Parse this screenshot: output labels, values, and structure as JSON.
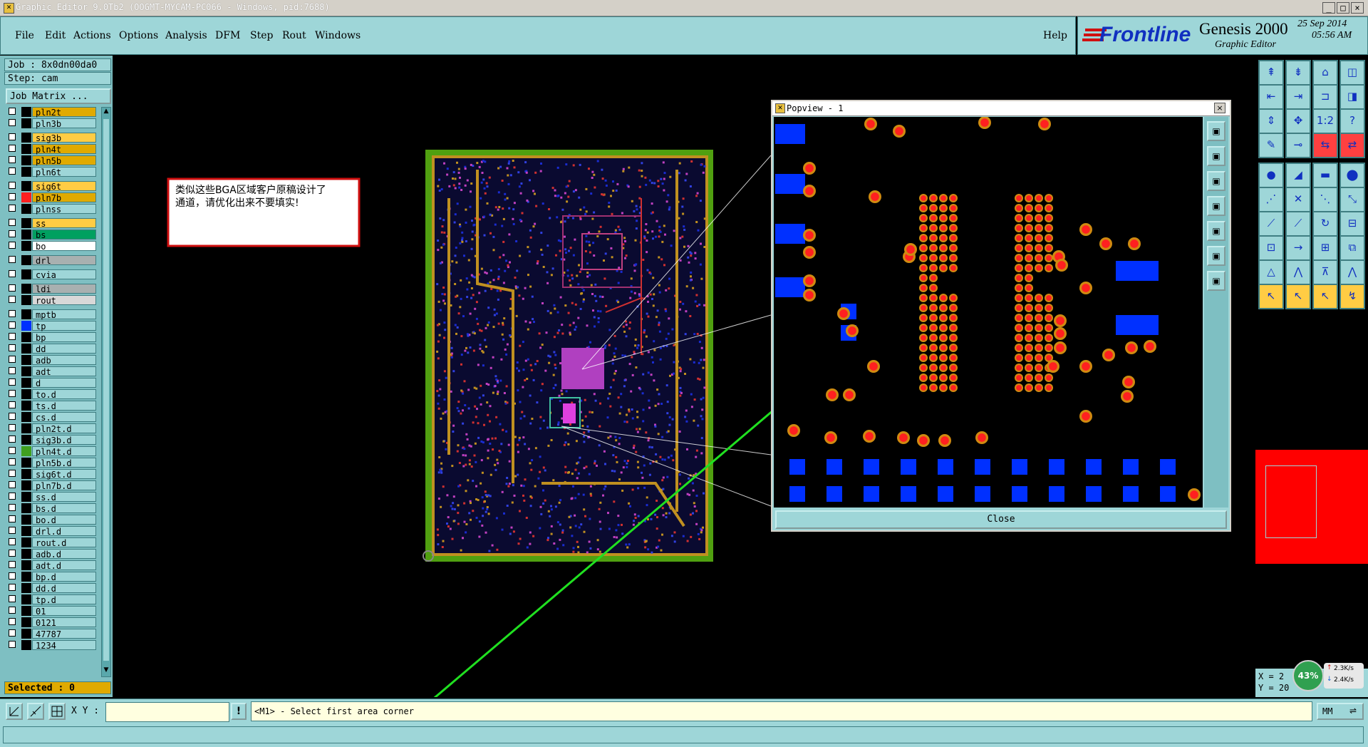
{
  "window": {
    "title": "Graphic Editor 9.0Tb2 (OOGMT-MYCAM-PC066 - Windows, pid:7688)"
  },
  "menubar": {
    "items": [
      "File",
      "Edit",
      "Actions",
      "Options",
      "Analysis",
      "DFM",
      "Step",
      "Rout",
      "Windows"
    ],
    "help": "Help"
  },
  "brand": {
    "logo": "Frontline",
    "product": "Genesis 2000",
    "subtitle": "Graphic Editor",
    "date": "25 Sep 2014",
    "time": "05:56 AM"
  },
  "left_panel": {
    "job": "Job : 8x0dn00da0",
    "step": "Step: cam",
    "job_matrix": "Job Matrix ...",
    "selected": "Selected : 0",
    "layers": [
      {
        "name": "pln2t",
        "color": "#e0aa00",
        "swatch": "#000"
      },
      {
        "name": "pln3b",
        "color": "#9ed6d8",
        "swatch": "#000"
      },
      {
        "name": "sig3b",
        "color": "#ffcc44",
        "swatch": "#000"
      },
      {
        "name": "pln4t",
        "color": "#e0aa00",
        "swatch": "#000"
      },
      {
        "name": "pln5b",
        "color": "#e0aa00",
        "swatch": "#000"
      },
      {
        "name": "pln6t",
        "color": "#9ed6d8",
        "swatch": "#000"
      },
      {
        "name": "sig6t",
        "color": "#ffcc44",
        "swatch": "#000"
      },
      {
        "name": "pln7b",
        "color": "#e0aa00",
        "swatch": "#ff2020"
      },
      {
        "name": "plnss",
        "color": "#9ed6d8",
        "swatch": "#000"
      },
      {
        "name": "ss",
        "color": "#ffcc44",
        "swatch": "#000"
      },
      {
        "name": "bs",
        "color": "#00a060",
        "swatch": "#000"
      },
      {
        "name": "bo",
        "color": "#ffffff",
        "swatch": "#000"
      },
      {
        "name": "drl",
        "color": "#a8b0b0",
        "swatch": "#000"
      },
      {
        "name": "cvia",
        "color": "#9ed6d8",
        "swatch": "#000"
      },
      {
        "name": "ldi",
        "color": "#a8b0b0",
        "swatch": "#000"
      },
      {
        "name": "rout",
        "color": "#d8d8d8",
        "swatch": "#000"
      },
      {
        "name": "mptb",
        "color": "#9ed6d8",
        "swatch": "#000"
      },
      {
        "name": "tp",
        "color": "#9ed6d8",
        "swatch": "#0030ff"
      },
      {
        "name": "bp",
        "color": "#9ed6d8",
        "swatch": "#000"
      },
      {
        "name": "dd",
        "color": "#9ed6d8",
        "swatch": "#000"
      },
      {
        "name": "adb",
        "color": "#9ed6d8",
        "swatch": "#000"
      },
      {
        "name": "adt",
        "color": "#9ed6d8",
        "swatch": "#000"
      },
      {
        "name": "d",
        "color": "#9ed6d8",
        "swatch": "#000"
      },
      {
        "name": "to.d",
        "color": "#9ed6d8",
        "swatch": "#000"
      },
      {
        "name": "ts.d",
        "color": "#9ed6d8",
        "swatch": "#000"
      },
      {
        "name": "cs.d",
        "color": "#9ed6d8",
        "swatch": "#000"
      },
      {
        "name": "pln2t.d",
        "color": "#9ed6d8",
        "swatch": "#000"
      },
      {
        "name": "sig3b.d",
        "color": "#9ed6d8",
        "swatch": "#000"
      },
      {
        "name": "pln4t.d",
        "color": "#9ed6d8",
        "swatch": "#40a020"
      },
      {
        "name": "pln5b.d",
        "color": "#9ed6d8",
        "swatch": "#000"
      },
      {
        "name": "sig6t.d",
        "color": "#9ed6d8",
        "swatch": "#000"
      },
      {
        "name": "pln7b.d",
        "color": "#9ed6d8",
        "swatch": "#000"
      },
      {
        "name": "ss.d",
        "color": "#9ed6d8",
        "swatch": "#000"
      },
      {
        "name": "bs.d",
        "color": "#9ed6d8",
        "swatch": "#000"
      },
      {
        "name": "bo.d",
        "color": "#9ed6d8",
        "swatch": "#000"
      },
      {
        "name": "drl.d",
        "color": "#9ed6d8",
        "swatch": "#000"
      },
      {
        "name": "rout.d",
        "color": "#9ed6d8",
        "swatch": "#000"
      },
      {
        "name": "adb.d",
        "color": "#9ed6d8",
        "swatch": "#000"
      },
      {
        "name": "adt.d",
        "color": "#9ed6d8",
        "swatch": "#000"
      },
      {
        "name": "bp.d",
        "color": "#9ed6d8",
        "swatch": "#000"
      },
      {
        "name": "dd.d",
        "color": "#9ed6d8",
        "swatch": "#000"
      },
      {
        "name": "tp.d",
        "color": "#9ed6d8",
        "swatch": "#000"
      },
      {
        "name": "01",
        "color": "#9ed6d8",
        "swatch": "#000"
      },
      {
        "name": "0121",
        "color": "#9ed6d8",
        "swatch": "#000"
      },
      {
        "name": "47787",
        "color": "#9ed6d8",
        "swatch": "#000"
      },
      {
        "name": "1234",
        "color": "#9ed6d8",
        "swatch": "#000"
      }
    ]
  },
  "annotation": {
    "line1": "类似这些BGA区域客户原稿设计了",
    "line2": "通道，请优化出来不要填实!"
  },
  "popview": {
    "title": "Popview - 1",
    "close": "Close"
  },
  "coords": {
    "x_label": "X = 2",
    "y_label": "Y = 20",
    "gauge_percent": "43%",
    "up_rate": "2.3K/s",
    "down_rate": "2.4K/s"
  },
  "command": {
    "xy_label": "X Y :",
    "xy_value": "",
    "prompt": "<M1> - Select first area corner",
    "units": "MM"
  },
  "colors": {
    "panel": "#9ed6d8",
    "panel_dark": "#3f7e82",
    "pad_red": "#ff2020",
    "pad_orange": "#d08a10",
    "pad_blue": "#0030ff",
    "arrow": "#20e020"
  }
}
